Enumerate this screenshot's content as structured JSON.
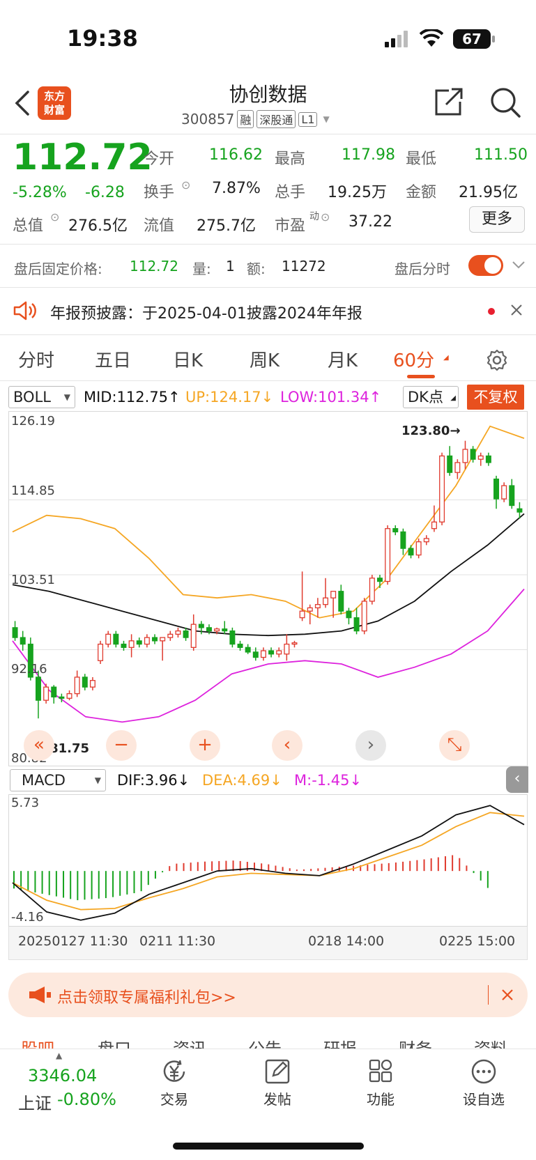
{
  "status_bar": {
    "time": "19:38",
    "battery": "67"
  },
  "header": {
    "title": "协创数据",
    "logo_text": "东方\n财富",
    "code": "300857",
    "tags": [
      "融",
      "深股通",
      "L1"
    ]
  },
  "quote": {
    "price": "112.72",
    "change_pct": "-5.28%",
    "change": "-6.28",
    "open_label": "今开",
    "open": "116.62",
    "high_label": "最高",
    "high": "117.98",
    "low_label": "最低",
    "low": "111.50",
    "turnover_label": "换手",
    "turnover": "7.87%",
    "volume_label": "总手",
    "volume": "19.25万",
    "amount_label": "金额",
    "amount": "21.95亿",
    "mktcap_label": "总值",
    "mktcap": "276.5亿",
    "float_label": "流值",
    "float": "275.7亿",
    "pe_label": "市盈",
    "pe_sup": "动",
    "pe": "37.22",
    "more_label": "更多"
  },
  "after_hours": {
    "price_label": "盘后固定价格:",
    "price": "112.72",
    "vol_label": "量:",
    "vol": "1",
    "amt_label": "额:",
    "amt": "11272",
    "toggle_label": "盘后分时",
    "toggle_on": true
  },
  "notice": {
    "text": "年报预披露：于2025-04-01披露2024年年报"
  },
  "chart_tabs": [
    "分时",
    "五日",
    "日K",
    "周K",
    "月K",
    "60分"
  ],
  "active_tab": "60分",
  "indicators": {
    "main_select": "BOLL",
    "mid": "MID:112.75↑",
    "up": "UP:124.17↓",
    "low": "LOW:101.34↑",
    "dk": "DK点",
    "adjust": "不复权",
    "price_axis": [
      "126.19",
      "114.85",
      "103.51",
      "92.16",
      "80.82"
    ],
    "high_mark": "123.80→",
    "low_mark": "←81.75",
    "sub_select": "MACD",
    "dif": "DIF:3.96↓",
    "dea": "DEA:4.69↓",
    "m": "M:-1.45↓",
    "macd_axis": [
      "5.73",
      "-4.16"
    ],
    "time_axis": [
      "20250127 11:30",
      "0211 11:30",
      "0218 14:00",
      "0225 15:00"
    ]
  },
  "colors": {
    "up": "#e03a2e",
    "down": "#16a31e",
    "mid": "#111111",
    "upper": "#f5a623",
    "lower": "#dd22dd",
    "accent": "#e8501e"
  },
  "banner": {
    "text": "点击领取专属福利礼包>>"
  },
  "hidden_tabs": [
    "股吧",
    "盘口",
    "资讯",
    "公告",
    "研报",
    "财务",
    "资料"
  ],
  "bottom_nav": {
    "index_value": "3346.04",
    "index_name": "上证",
    "index_change": "-0.80%",
    "items": [
      "交易",
      "发帖",
      "功能",
      "设自选"
    ]
  },
  "chart_data": {
    "type": "candlestick",
    "ylim": [
      80.82,
      126.19
    ],
    "candles": [
      [
        95.5,
        96.5,
        93.5,
        94.0
      ],
      [
        94.0,
        95.0,
        92.0,
        93.0
      ],
      [
        93.0,
        94.0,
        87.5,
        88.0
      ],
      [
        88.0,
        89.0,
        81.75,
        84.5
      ],
      [
        84.5,
        87.0,
        84.0,
        86.5
      ],
      [
        86.5,
        86.8,
        84.0,
        85.0
      ],
      [
        85.0,
        85.5,
        84.2,
        84.8
      ],
      [
        84.8,
        86.0,
        84.5,
        85.5
      ],
      [
        85.5,
        89.0,
        85.0,
        88.0
      ],
      [
        88.0,
        88.5,
        86.0,
        86.5
      ],
      [
        86.5,
        88.0,
        86.0,
        87.5
      ],
      [
        90.5,
        93.5,
        90.0,
        93.0
      ],
      [
        93.0,
        95.0,
        92.5,
        94.5
      ],
      [
        94.5,
        95.0,
        92.5,
        93.0
      ],
      [
        93.0,
        93.5,
        92.0,
        92.5
      ],
      [
        92.5,
        94.5,
        91.0,
        93.5
      ],
      [
        93.5,
        94.0,
        92.5,
        93.0
      ],
      [
        93.0,
        94.5,
        92.5,
        94.0
      ],
      [
        94.0,
        94.5,
        93.0,
        93.5
      ],
      [
        93.5,
        94.0,
        90.5,
        94.0
      ],
      [
        94.0,
        95.0,
        93.5,
        94.5
      ],
      [
        94.5,
        95.5,
        94.0,
        95.0
      ],
      [
        95.0,
        95.5,
        93.5,
        94.0
      ],
      [
        92.5,
        97.5,
        92.0,
        96.0
      ],
      [
        96.0,
        96.5,
        94.5,
        95.5
      ],
      [
        95.5,
        96.0,
        94.5,
        95.0
      ],
      [
        95.0,
        95.5,
        94.5,
        95.3
      ],
      [
        95.3,
        96.5,
        94.5,
        95.0
      ],
      [
        95.0,
        95.5,
        92.5,
        93.0
      ],
      [
        93.0,
        93.5,
        92.0,
        92.5
      ],
      [
        92.5,
        93.0,
        91.5,
        91.8
      ],
      [
        91.8,
        92.5,
        90.5,
        91.0
      ],
      [
        91.0,
        92.5,
        90.5,
        92.0
      ],
      [
        92.0,
        92.5,
        91.0,
        91.5
      ],
      [
        91.5,
        92.5,
        91.0,
        92.0
      ],
      [
        91.5,
        94.5,
        90.5,
        93.0
      ],
      [
        93.0,
        93.5,
        92.5,
        93.2
      ],
      [
        97.0,
        104.0,
        96.5,
        98.0
      ],
      [
        98.0,
        99.0,
        96.0,
        98.5
      ],
      [
        98.5,
        100.0,
        97.0,
        99.0
      ],
      [
        99.0,
        103.0,
        98.5,
        100.0
      ],
      [
        100.0,
        101.0,
        97.0,
        101.0
      ],
      [
        101.0,
        102.0,
        97.5,
        98.0
      ],
      [
        98.0,
        98.5,
        96.0,
        97.0
      ],
      [
        97.0,
        98.5,
        94.5,
        95.0
      ],
      [
        95.0,
        100.0,
        94.5,
        99.5
      ],
      [
        99.5,
        103.5,
        99.0,
        103.0
      ],
      [
        103.0,
        103.5,
        101.5,
        102.5
      ],
      [
        102.5,
        111.0,
        102.0,
        110.5
      ],
      [
        110.5,
        111.0,
        109.5,
        110.0
      ],
      [
        110.0,
        110.5,
        106.5,
        107.5
      ],
      [
        107.5,
        108.0,
        106.0,
        106.5
      ],
      [
        106.5,
        109.0,
        106.0,
        108.5
      ],
      [
        108.5,
        109.5,
        108.0,
        109.0
      ],
      [
        110.5,
        114.0,
        110.0,
        111.5
      ],
      [
        111.5,
        122.0,
        111.0,
        121.5
      ],
      [
        121.5,
        123.0,
        118.5,
        119.0
      ],
      [
        119.0,
        121.0,
        118.0,
        120.5
      ],
      [
        120.5,
        123.8,
        119.5,
        122.5
      ],
      [
        122.5,
        123.0,
        120.5,
        121.0
      ],
      [
        121.0,
        122.0,
        120.0,
        121.5
      ],
      [
        121.5,
        122.0,
        120.0,
        120.5
      ],
      [
        118.0,
        118.5,
        113.5,
        115.0
      ],
      [
        115.0,
        117.5,
        114.5,
        117.0
      ],
      [
        117.0,
        118.0,
        113.5,
        114.0
      ],
      [
        113.5,
        114.5,
        112.0,
        113.0
      ]
    ],
    "mid_line": [
      102.0,
      101.0,
      99.5,
      98.0,
      96.5,
      95.0,
      94.5,
      94.3,
      94.5,
      95.0,
      96.5,
      99.5,
      104.0,
      108.0,
      112.75
    ],
    "upper_line": [
      110.0,
      112.5,
      112.0,
      110.5,
      106.0,
      100.5,
      100.0,
      100.5,
      99.5,
      97.0,
      98.0,
      103.0,
      110.0,
      117.0,
      126.0,
      124.17
    ],
    "lower_line": [
      93.5,
      86.0,
      82.0,
      81.2,
      82.0,
      84.5,
      88.5,
      90.0,
      90.5,
      90.0,
      88.0,
      89.5,
      91.5,
      95.0,
      101.34
    ],
    "macd": {
      "ylim": [
        -4.16,
        5.73
      ],
      "dif": [
        -1.0,
        -3.5,
        -4.2,
        -3.6,
        -2.0,
        -1.0,
        0.0,
        0.2,
        -0.2,
        -0.4,
        0.6,
        1.8,
        3.0,
        4.8,
        5.6,
        3.96
      ],
      "dea": [
        -1.0,
        -2.5,
        -3.3,
        -3.2,
        -2.3,
        -1.5,
        -0.5,
        -0.2,
        -0.3,
        -0.4,
        0.2,
        1.2,
        2.2,
        3.8,
        5.0,
        4.69
      ],
      "hist": [
        -1.5,
        -2.0,
        -2.5,
        -2.3,
        -1.8,
        0.6,
        0.8,
        0.9,
        0.6,
        0.1,
        0.3,
        0.5,
        0.7,
        1.0,
        1.4,
        -1.45
      ]
    }
  }
}
